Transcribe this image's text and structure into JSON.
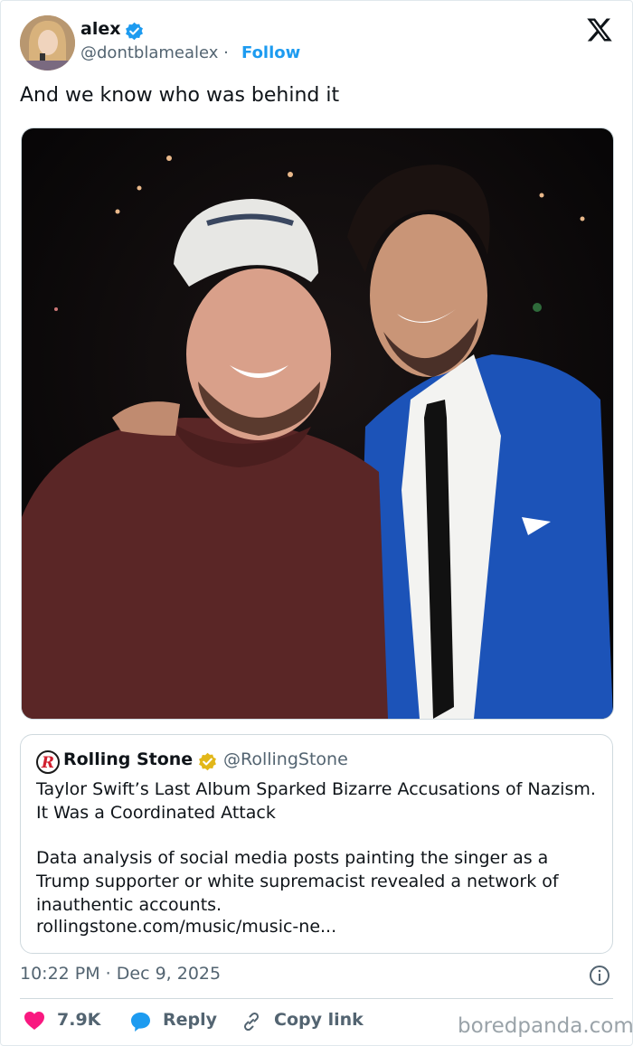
{
  "author": {
    "name": "alex",
    "handle": "@dontblamealex",
    "separator": "·",
    "follow_label": "Follow"
  },
  "tweet": {
    "text": "And we know who was behind it"
  },
  "quote": {
    "name": "Rolling Stone",
    "handle": "@RollingStone",
    "title": "Taylor Swift’s Last Album Sparked Bizarre Accusations of Nazism. It Was a Coordinated Attack",
    "description": "Data analysis of social media posts painting the singer as a Trump supporter or white supremacist revealed a network of inauthentic accounts.",
    "link": "rollingstone.com/music/music-ne..."
  },
  "meta": {
    "time": "10:22 PM · Dec 9, 2025"
  },
  "actions": {
    "likes": "7.9K",
    "reply_label": "Reply",
    "copy_label": "Copy link"
  },
  "watermark": "boredpanda.com",
  "icons": {
    "verified": "verified-badge-icon",
    "x_logo": "x-logo-icon",
    "info": "info-icon",
    "heart": "heart-icon",
    "reply": "reply-icon",
    "link": "link-icon"
  },
  "colors": {
    "accent": "#1d9bf0",
    "heart": "#f91880",
    "gold_badge": "#e2b719",
    "muted": "#536471"
  }
}
